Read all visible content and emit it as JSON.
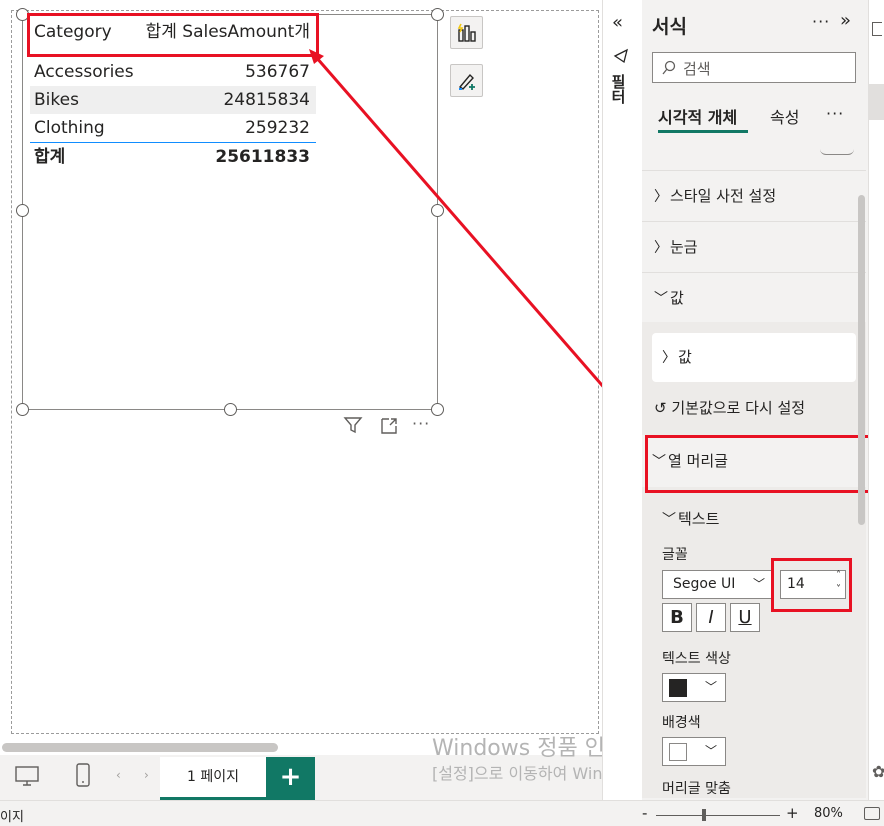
{
  "visual_table": {
    "header": {
      "category": "Category",
      "sales": "합계 SalesAmount개"
    },
    "rows": [
      {
        "category": "Accessories",
        "sales": "536767"
      },
      {
        "category": "Bikes",
        "sales": "24815834"
      },
      {
        "category": "Clothing",
        "sales": "259232"
      }
    ],
    "total": {
      "label": "합계",
      "value": "25611833"
    }
  },
  "filters_rail": {
    "label": "필터"
  },
  "format_pane": {
    "title": "서식",
    "more": "···",
    "search_placeholder": "검색",
    "tabs": {
      "visual": "시각적 개체",
      "general": "속성",
      "more": "···"
    },
    "sections": {
      "style_presets": "스타일 사전 설정",
      "grid": "눈금",
      "values": "값",
      "values_sub": "값",
      "reset": "기본값으로 다시 설정",
      "column_headers": "열 머리글",
      "text": "텍스트",
      "font_label": "글꼴",
      "font_family": "Segoe UI",
      "font_size": "14",
      "bold": "B",
      "italic": "I",
      "underline": "U",
      "text_color_label": "텍스트 색상",
      "bg_color_label": "배경색",
      "header_align_label": "머리글 맞춤"
    },
    "colors": {
      "text_color": "#252423",
      "bg_color": "#ffffff"
    }
  },
  "page_tabs": {
    "active": "1 페이지",
    "add": "+"
  },
  "watermark": {
    "line1": "Windows 정품 인증",
    "line2": "[설정]으로 이동하여 Windows를 정품 인증합니다."
  },
  "status_bar": {
    "page_label": "이지",
    "zoom_minus": "-",
    "zoom_plus": "+",
    "zoom": "80%"
  },
  "colors": {
    "accent": "#117865",
    "highlight": "#e81123",
    "total_line": "#118dff"
  }
}
